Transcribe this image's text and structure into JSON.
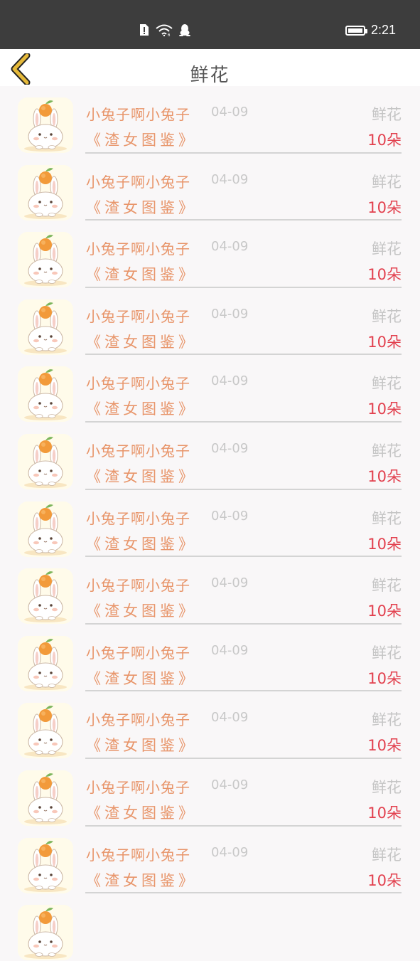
{
  "status_bar": {
    "time": "2:21"
  },
  "header": {
    "title": "鲜花"
  },
  "items": [
    {
      "name": "小兔子啊小兔子",
      "date": "04-09",
      "gift": "鲜花",
      "book": "《渣女图鉴》",
      "quantity": "10朵"
    },
    {
      "name": "小兔子啊小兔子",
      "date": "04-09",
      "gift": "鲜花",
      "book": "《渣女图鉴》",
      "quantity": "10朵"
    },
    {
      "name": "小兔子啊小兔子",
      "date": "04-09",
      "gift": "鲜花",
      "book": "《渣女图鉴》",
      "quantity": "10朵"
    },
    {
      "name": "小兔子啊小兔子",
      "date": "04-09",
      "gift": "鲜花",
      "book": "《渣女图鉴》",
      "quantity": "10朵"
    },
    {
      "name": "小兔子啊小兔子",
      "date": "04-09",
      "gift": "鲜花",
      "book": "《渣女图鉴》",
      "quantity": "10朵"
    },
    {
      "name": "小兔子啊小兔子",
      "date": "04-09",
      "gift": "鲜花",
      "book": "《渣女图鉴》",
      "quantity": "10朵"
    },
    {
      "name": "小兔子啊小兔子",
      "date": "04-09",
      "gift": "鲜花",
      "book": "《渣女图鉴》",
      "quantity": "10朵"
    },
    {
      "name": "小兔子啊小兔子",
      "date": "04-09",
      "gift": "鲜花",
      "book": "《渣女图鉴》",
      "quantity": "10朵"
    },
    {
      "name": "小兔子啊小兔子",
      "date": "04-09",
      "gift": "鲜花",
      "book": "《渣女图鉴》",
      "quantity": "10朵"
    },
    {
      "name": "小兔子啊小兔子",
      "date": "04-09",
      "gift": "鲜花",
      "book": "《渣女图鉴》",
      "quantity": "10朵"
    },
    {
      "name": "小兔子啊小兔子",
      "date": "04-09",
      "gift": "鲜花",
      "book": "《渣女图鉴》",
      "quantity": "10朵"
    },
    {
      "name": "小兔子啊小兔子",
      "date": "04-09",
      "gift": "鲜花",
      "book": "《渣女图鉴》",
      "quantity": "10朵"
    }
  ],
  "icons": {
    "back": "chevron-left-icon",
    "avatar": "rabbit-with-orange-avatar"
  },
  "colors": {
    "name": "#e8956a",
    "quantity": "#e2404e",
    "gift": "#c5c5c5",
    "back_icon": "#e5b93a"
  }
}
